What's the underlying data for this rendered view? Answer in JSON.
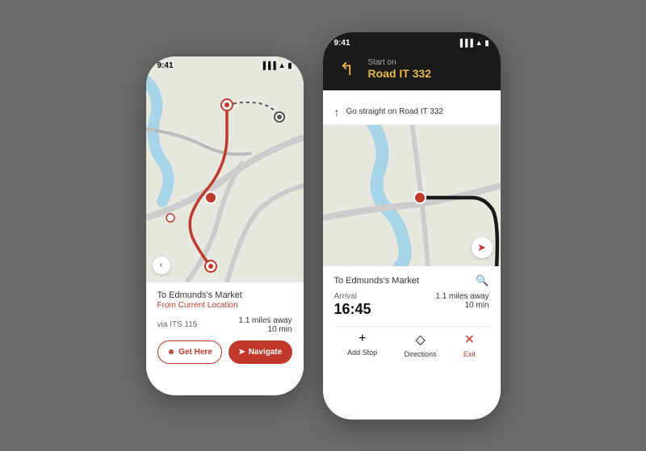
{
  "left_phone": {
    "status_time": "9:41",
    "destination": "To Edmunds's Market",
    "from_label": "From Current Location",
    "via": "via ITS 115",
    "distance": "1.1 miles away",
    "time": "10 min",
    "btn_get_here": "Get Here",
    "btn_navigate": "Navigate"
  },
  "right_phone": {
    "status_time": "9:41",
    "nav_start_on": "Start on",
    "nav_road": "Road IT 332",
    "next_instruction": "Go straight on Road IT 332",
    "destination": "To Edmunds's Market",
    "arrival_label": "Arrival",
    "arrival_time": "16:45",
    "distance": "1.1 miles away",
    "time": "10 min",
    "add_stop": "Add Stop",
    "directions": "Directions",
    "exit": "Exit"
  }
}
